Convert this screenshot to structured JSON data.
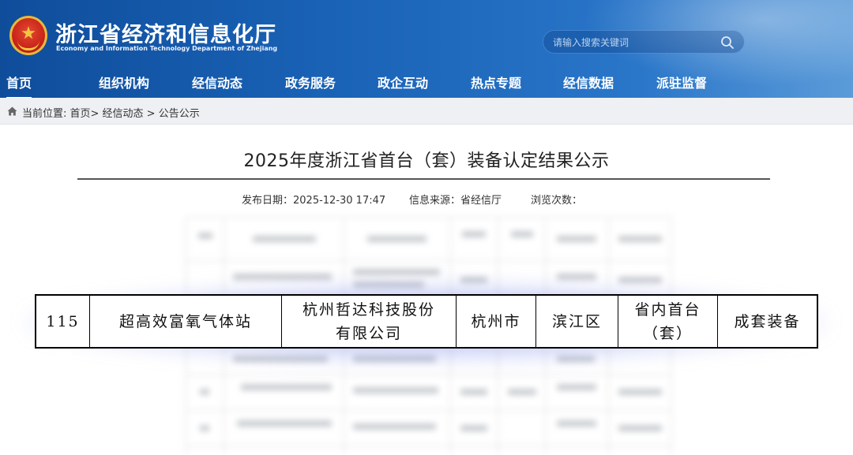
{
  "header": {
    "title": "浙江省经济和信息化厅",
    "subtitle": "Economy and Information Technology Department of Zhejiang",
    "search_placeholder": "请输入搜索关键词",
    "nav": [
      "首页",
      "组织机构",
      "经信动态",
      "政务服务",
      "政企互动",
      "热点专题",
      "经信数据",
      "派驻监督"
    ],
    "active_nav": "首页"
  },
  "breadcrumb": {
    "text": "当前位置: 首页> 经信动态 > 公告公示"
  },
  "article": {
    "title": "2025年度浙江省首台（套）装备认定结果公示",
    "publish_date": "发布日期：2025-12-30 17:47",
    "source": "信息来源：省经信厅",
    "views": "浏览次数："
  },
  "highlight_row": {
    "index": "115",
    "product": "超高效富氧气体站",
    "company_line1": "杭州哲达科技股份",
    "company_line2": "有限公司",
    "city": "杭州市",
    "district": "滨江区",
    "level_line1": "省内首台",
    "level_line2": "（套）",
    "category": "成套装备"
  },
  "colors": {
    "header_blue": "#1a63b7",
    "breadcrumb_bg": "#eef0f3",
    "highlight_glow": "#5f6edc"
  },
  "icons": [
    "national-emblem-icon",
    "search-icon",
    "home-icon"
  ]
}
